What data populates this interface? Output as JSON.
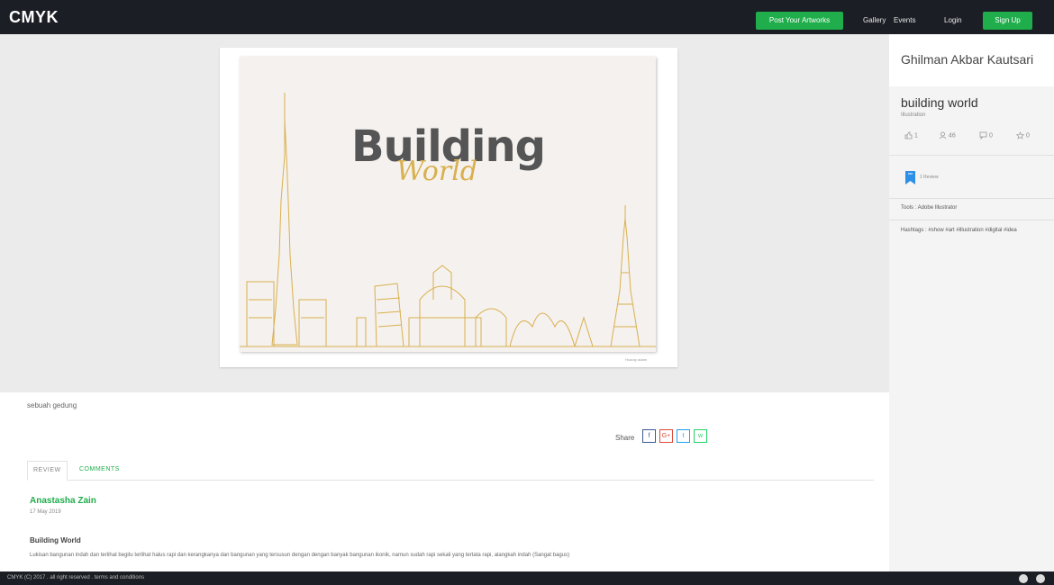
{
  "nav": {
    "logo": "CMYK",
    "post_button": "Post Your Artworks",
    "links": [
      "Gallery",
      "Events",
      "Login"
    ],
    "signup_button": "Sign Up"
  },
  "artwork": {
    "title_main": "Building",
    "title_sub": "World",
    "credit": "Hooray adam"
  },
  "description": "sebuah gedung",
  "share": {
    "label": "Share",
    "buttons": [
      {
        "icon": "facebook-icon",
        "glyph": "f",
        "color": "#3b5998"
      },
      {
        "icon": "google-plus-icon",
        "glyph": "G+",
        "color": "#dd4b39"
      },
      {
        "icon": "twitter-icon",
        "glyph": "t",
        "color": "#1da1f2"
      },
      {
        "icon": "whatsapp-icon",
        "glyph": "w",
        "color": "#25d366"
      }
    ]
  },
  "tabs": {
    "review": "Review",
    "comments": "Comments"
  },
  "review": {
    "author": "Anastasha Zain",
    "date": "17 May 2019",
    "title": "Building World",
    "body": "Lukisan bangunan indah dan terlihat begitu terlihat halus rapi dan kerangkanya dan bangunan yang tersusun dengan dengan banyak bangunan ikonik, namun sudah rapi sekali yang tertata rapi, alangkah indah (Sangat bagus)"
  },
  "sidebar": {
    "artist_name": "Ghilman Akbar Kautsari",
    "art_name": "building world",
    "category": "Illustration",
    "stats": {
      "likes": "1",
      "views": "46",
      "comments": "0",
      "rating": "0"
    },
    "review_count": "1 Review",
    "tools": "Tools : Adobe Illustrator",
    "hashtags": "Hashtags : #show #art #illustration #digital #idea"
  },
  "footer": {
    "copyright": "CMYK (C) 2017 . all right reserved . terms and conditions"
  },
  "colors": {
    "accent_green": "#1fae4b",
    "nav_dark": "#1b1e24",
    "gold": "#d8b04d"
  }
}
